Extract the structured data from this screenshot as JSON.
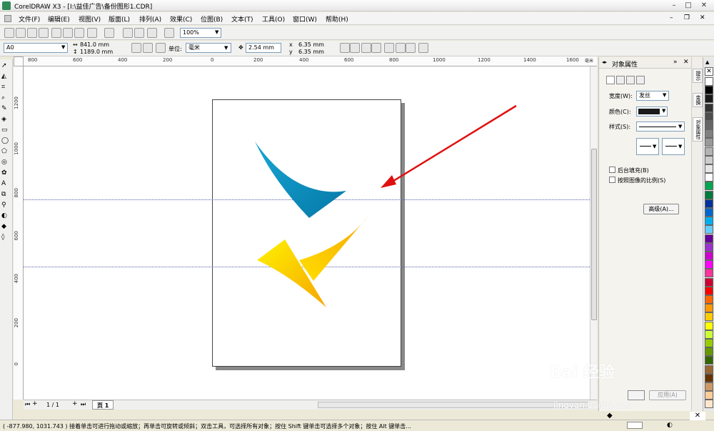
{
  "window": {
    "title": "CorelDRAW X3 - [I:\\益佳广告\\备份图形1.CDR]",
    "controls": [
      "–",
      "□",
      "✕"
    ]
  },
  "menu": {
    "items": [
      "文件(F)",
      "编辑(E)",
      "视图(V)",
      "版面(L)",
      "排列(A)",
      "效果(C)",
      "位图(B)",
      "文本(T)",
      "工具(O)",
      "窗口(W)",
      "帮助(H)"
    ]
  },
  "standard_toolbar": {
    "zoom_value": "100%"
  },
  "property_bar": {
    "paper_size": "A0",
    "width": "841.0 mm",
    "height": "1189.0 mm",
    "units_label": "单位:",
    "units_value": "毫米",
    "nudge": "2.54 mm",
    "duplicate_x": "6.35 mm",
    "duplicate_y": "6.35 mm"
  },
  "rulers": {
    "horizontal_ticks": [
      "800",
      "600",
      "400",
      "200",
      "0",
      "200",
      "400",
      "600",
      "800",
      "1000",
      "1200",
      "1400",
      "1600"
    ],
    "horizontal_unit": "毫米",
    "vertical_ticks": [
      "1200",
      "1000",
      "800",
      "600",
      "400",
      "200",
      "0"
    ]
  },
  "page_nav": {
    "counter": "1 / 1",
    "tab_label": "页 1"
  },
  "status": {
    "text": "( -877.980, 1031.743 )  接着单击可进行拖动或缩放；再单击可旋转或倾斜；双击工具，可选择所有对象；按住 Shift 键单击可选择多个对象；按住 Alt 键单击..."
  },
  "docker": {
    "title": "对象属性",
    "width_label": "宽度(W):",
    "width_value": "发丝",
    "color_label": "颜色(C):",
    "style_label": "样式(S):",
    "behind_fill_label": "后台填充(B)",
    "scale_with_image_label": "按照图像的比例(S)",
    "advanced_button": "高级(A)...",
    "apply_button": "应用(A)"
  },
  "docker_tabs": [
    "提示",
    "变换",
    "对象属性"
  ],
  "palette": {
    "colors": [
      "#ffffff",
      "#000000",
      "#1a1a1a",
      "#333333",
      "#4d4d4d",
      "#666666",
      "#808080",
      "#999999",
      "#b3b3b3",
      "#cccccc",
      "#e6e6e6",
      "#ffffff",
      "#00a651",
      "#007a3d",
      "#003399",
      "#0066cc",
      "#00aeef",
      "#66ccff",
      "#660099",
      "#9933cc",
      "#cc00cc",
      "#ff00ff",
      "#ff3399",
      "#cc0033",
      "#ff0000",
      "#ff6600",
      "#ff9900",
      "#ffcc00",
      "#ffff00",
      "#ccff33",
      "#99cc00",
      "#669900",
      "#336600",
      "#996633",
      "#663300",
      "#cc9966",
      "#ffcc99",
      "#ffe6cc"
    ]
  },
  "watermark": {
    "text": "Bai 经验",
    "url": "jingyan.baidu.com"
  },
  "colors": {
    "blue_shape": "#0a8fc0",
    "yellow_shape": "#ffd000",
    "orange_shape": "#f0a000",
    "arrow": "#e01010"
  }
}
